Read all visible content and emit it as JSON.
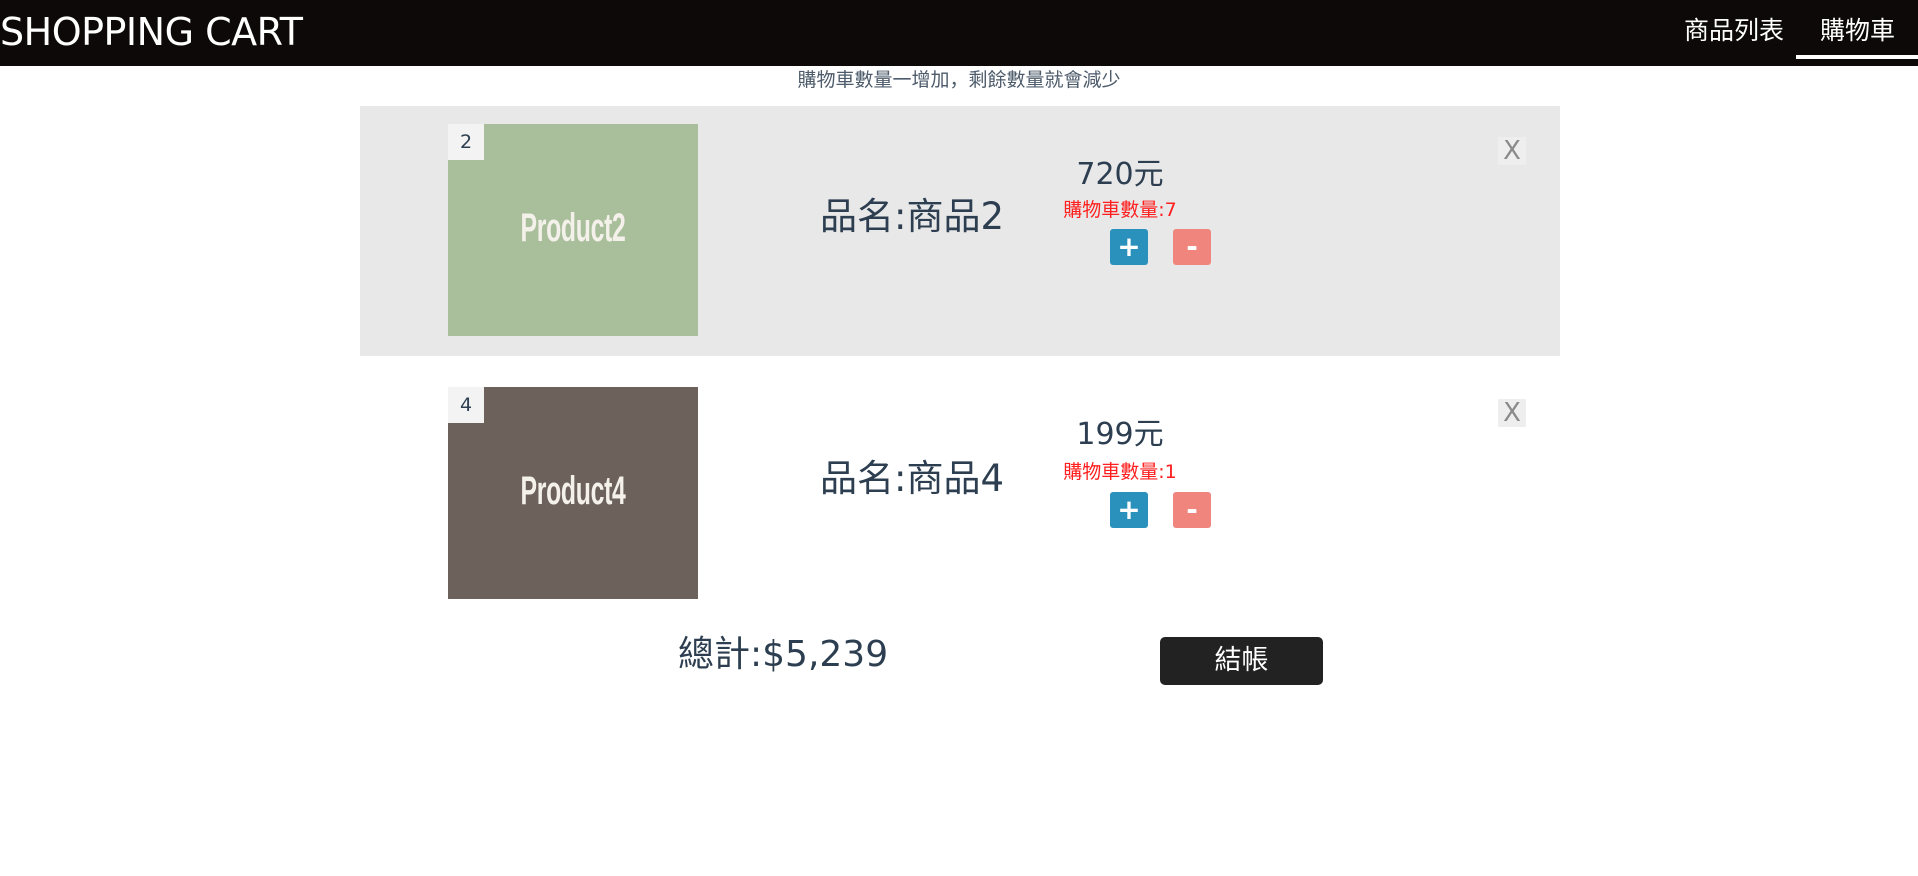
{
  "header": {
    "brand": "SHOPPING CART",
    "nav": [
      {
        "label": "商品列表",
        "active": false
      },
      {
        "label": "購物車",
        "active": true
      }
    ]
  },
  "notice": "購物車數量一增加，剩餘數量就會減少",
  "cart": {
    "items": [
      {
        "id": "2",
        "image_text": "Product2",
        "image_color": "#a9bf9c",
        "name": "品名:商品2",
        "price": "720元",
        "quantity": "購物車數量:7",
        "plus_label": "+",
        "minus_label": "-",
        "remove_label": "X",
        "highlighted": true
      },
      {
        "id": "4",
        "image_text": "Product4",
        "image_color": "#6c615b",
        "name": "品名:商品4",
        "price": "199元",
        "quantity": "購物車數量:1",
        "plus_label": "+",
        "minus_label": "-",
        "remove_label": "X",
        "highlighted": false
      }
    ],
    "total": "總計:$5,239",
    "checkout_label": "結帳"
  },
  "colors": {
    "navbar_bg": "#0d0908",
    "highlight_row_bg": "#e8e8e8",
    "plus_button": "#2a91bd",
    "minus_button": "#f0857e",
    "quantity_text": "#ff1f1f",
    "checkout_button": "#222222"
  }
}
